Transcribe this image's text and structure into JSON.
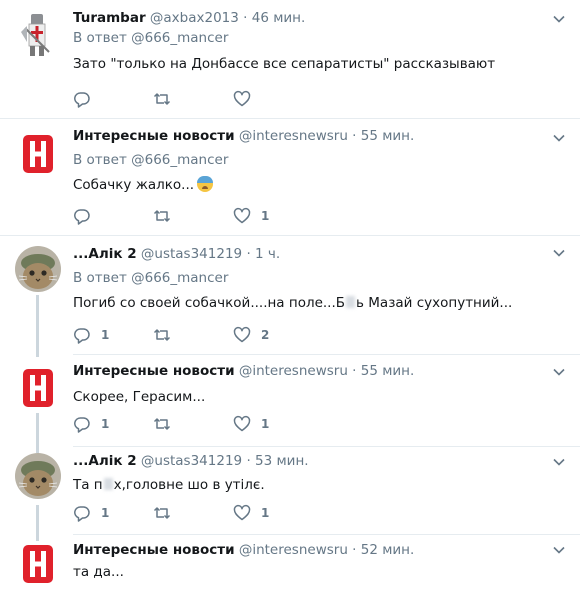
{
  "colors": {
    "text": "#14171a",
    "secondary": "#657786",
    "separator": "#e6ecf0",
    "thread_line": "#ccd6dd",
    "news_logo_red": "#e0212b"
  },
  "tweets": [
    {
      "fullname": "Turambar",
      "username": "@axbax2013",
      "time": "· 46 мин.",
      "reply_prefix": "В ответ",
      "reply_to": "@666_mancer",
      "text": "Зато \"только на Донбассе все сепаратисты\" рассказывают",
      "counts": {
        "reply": "",
        "retweet": "",
        "like": ""
      },
      "avatar_icon": "knight-avatar"
    },
    {
      "fullname": "Интересные новости",
      "username": "@interesnewsru",
      "time": "· 55 мин.",
      "reply_prefix": "В ответ",
      "reply_to": "@666_mancer",
      "text": "Собачку жалко...",
      "counts": {
        "reply": "",
        "retweet": "",
        "like": "1"
      },
      "avatar_icon": "news-h-logo"
    },
    {
      "fullname": "...Алік 2",
      "username": "@ustas341219",
      "time": "· 1 ч.",
      "reply_prefix": "В ответ",
      "reply_to": "@666_mancer",
      "text_a": "Погиб со своей собачкой....на поле...Б",
      "text_b": "ь Мазай сухопутний...",
      "counts": {
        "reply": "1",
        "retweet": "",
        "like": "2"
      },
      "avatar_icon": "cat-avatar"
    },
    {
      "fullname": "Интересные новости",
      "username": "@interesnewsru",
      "time": "· 55 мин.",
      "text": "Скорее, Герасим...",
      "counts": {
        "reply": "1",
        "retweet": "",
        "like": "1"
      },
      "avatar_icon": "news-h-logo"
    },
    {
      "fullname": "...Алік 2",
      "username": "@ustas341219",
      "time": "· 53 мин.",
      "text_a": "Та п",
      "text_b": "х,головне шо в утілє.",
      "counts": {
        "reply": "1",
        "retweet": "",
        "like": "1"
      },
      "avatar_icon": "cat-avatar"
    },
    {
      "fullname": "Интересные новости",
      "username": "@interesnewsru",
      "time": "· 52 мин.",
      "text": "та да...",
      "avatar_icon": "news-h-logo"
    }
  ]
}
